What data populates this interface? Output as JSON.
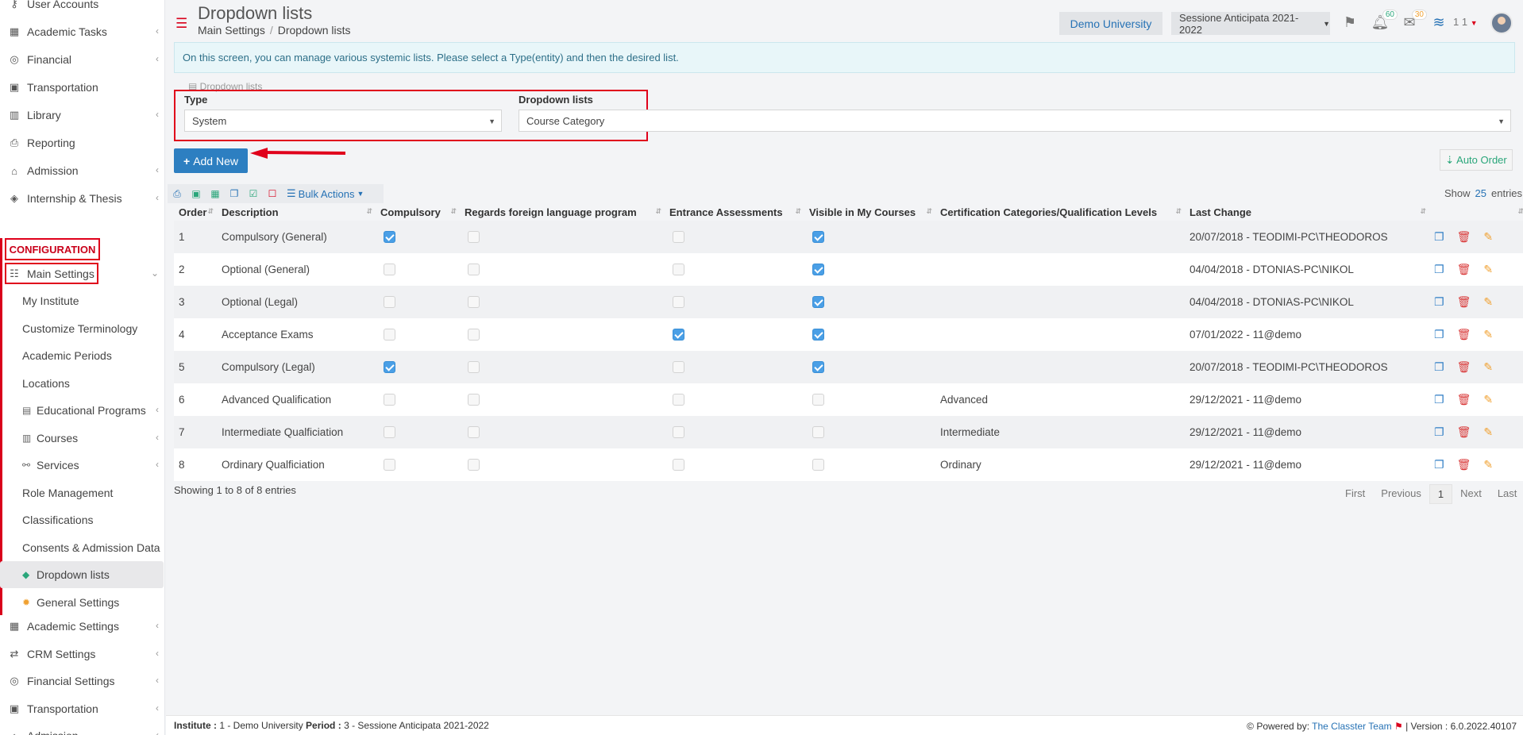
{
  "sidebar": {
    "top_items": [
      {
        "label": "User Accounts",
        "icon": "key-icon"
      },
      {
        "label": "Academic Tasks",
        "icon": "grid-icon"
      },
      {
        "label": "Financial",
        "icon": "coins-icon"
      },
      {
        "label": "Transportation",
        "icon": "bus-icon"
      },
      {
        "label": "Library",
        "icon": "books-icon"
      },
      {
        "label": "Reporting",
        "icon": "printer-icon"
      },
      {
        "label": "Admission",
        "icon": "bank-icon"
      },
      {
        "label": "Internship & Thesis",
        "icon": "box-icon"
      }
    ],
    "config_label": "CONFIGURATION",
    "main_settings": "Main Settings",
    "sub_items": [
      "My Institute",
      "Customize Terminology",
      "Academic Periods",
      "Locations",
      "Educational Programs",
      "Courses",
      "Services",
      "Role Management",
      "Classifications",
      "Consents & Admission Data",
      "Dropdown lists",
      "General Settings"
    ],
    "bottom_items": [
      {
        "label": "Academic Settings"
      },
      {
        "label": "CRM Settings"
      },
      {
        "label": "Financial Settings"
      },
      {
        "label": "Transportation"
      },
      {
        "label": "Admission"
      }
    ]
  },
  "header": {
    "title": "Dropdown lists",
    "breadcrumb": [
      "Main Settings",
      "Dropdown lists"
    ],
    "university": "Demo University",
    "period": "Sessione Anticipata 2021-2022",
    "notifications_count": "60",
    "messages_count": "30",
    "user_count": "1 1"
  },
  "info_text": "On this screen, you can manage various systemic lists. Please select a Type(entity) and then the desired list.",
  "panel_label": "Dropdown lists",
  "form": {
    "type_label": "Type",
    "type_value": "System",
    "dropdown_label": "Dropdown lists",
    "dropdown_value": "Course Category"
  },
  "buttons": {
    "add_new": "Add New",
    "auto_order": "Auto Order",
    "bulk_actions": "Bulk Actions"
  },
  "show": {
    "label": "Show",
    "value": "25",
    "suffix": "entries"
  },
  "table": {
    "columns": [
      "Order",
      "Description",
      "Compulsory",
      "Regards foreign language program",
      "Entrance Assessments",
      "Visible in My Courses",
      "Certification Categories/Qualification Levels",
      "Last Change"
    ],
    "rows": [
      {
        "order": "1",
        "description": "Compulsory (General)",
        "compulsory": true,
        "foreign": false,
        "entrance": false,
        "visible": true,
        "cert": "",
        "last_change": "20/07/2018 - TEODIMI-PC\\THEODOROS"
      },
      {
        "order": "2",
        "description": "Optional (General)",
        "compulsory": false,
        "foreign": false,
        "entrance": false,
        "visible": true,
        "cert": "",
        "last_change": "04/04/2018 - DTONIAS-PC\\NIKOL"
      },
      {
        "order": "3",
        "description": "Optional (Legal)",
        "compulsory": false,
        "foreign": false,
        "entrance": false,
        "visible": true,
        "cert": "",
        "last_change": "04/04/2018 - DTONIAS-PC\\NIKOL"
      },
      {
        "order": "4",
        "description": "Acceptance Exams",
        "compulsory": false,
        "foreign": false,
        "entrance": true,
        "visible": true,
        "cert": "",
        "last_change": "07/01/2022 - 11@demo"
      },
      {
        "order": "5",
        "description": "Compulsory (Legal)",
        "compulsory": true,
        "foreign": false,
        "entrance": false,
        "visible": true,
        "cert": "",
        "last_change": "20/07/2018 - TEODIMI-PC\\THEODOROS"
      },
      {
        "order": "6",
        "description": "Advanced Qualification",
        "compulsory": false,
        "foreign": false,
        "entrance": false,
        "visible": false,
        "cert": "Advanced",
        "last_change": "29/12/2021 - 11@demo"
      },
      {
        "order": "7",
        "description": "Intermediate Qualficiation",
        "compulsory": false,
        "foreign": false,
        "entrance": false,
        "visible": false,
        "cert": "Intermediate",
        "last_change": "29/12/2021 - 11@demo"
      },
      {
        "order": "8",
        "description": "Ordinary Qualficiation",
        "compulsory": false,
        "foreign": false,
        "entrance": false,
        "visible": false,
        "cert": "Ordinary",
        "last_change": "29/12/2021 - 11@demo"
      }
    ]
  },
  "showing": "Showing 1 to 8 of 8 entries",
  "pager": {
    "first": "First",
    "previous": "Previous",
    "current": "1",
    "next": "Next",
    "last": "Last"
  },
  "footer": {
    "institute_label": "Institute :",
    "institute_value": "1 - Demo University",
    "period_label": "Period :",
    "period_value": "3 - Sessione Anticipata 2021-2022",
    "powered_by": "Powered by:",
    "team": "The Classter Team",
    "version": "| Version : 6.0.2022.40107"
  }
}
